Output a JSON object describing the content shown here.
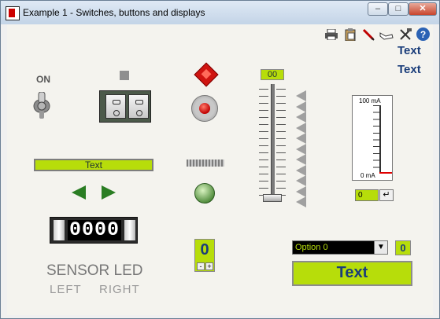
{
  "window": {
    "title": "Example 1 - Switches, buttons and displays",
    "buttons": {
      "minimize": "–",
      "maximize": "□",
      "close": "✕"
    }
  },
  "toolbar": {
    "icons": [
      "printer-icon",
      "clipboard-icon",
      "pen-icon",
      "hand-icon",
      "tools-icon",
      "help-icon"
    ],
    "help_glyph": "?"
  },
  "labels": {
    "text_top1": "Text",
    "text_top2": "Text",
    "on": "ON",
    "green_bar": "Text",
    "sensor": "SENSOR LED",
    "left": "LEFT",
    "right": "RIGHT",
    "big_button": "Text"
  },
  "counter": {
    "digits": "0000"
  },
  "slider": {
    "display": "00"
  },
  "meter": {
    "top_label": "100 mA",
    "bottom_label": "0 mA",
    "value_fraction": 0.0,
    "input_value": "0",
    "enter_glyph": "↵"
  },
  "stepper": {
    "value": "0",
    "minus": "-",
    "plus": "+"
  },
  "select": {
    "value": "Option 0",
    "arrow": "▼",
    "number": "0"
  },
  "colors": {
    "accent_green": "#b7dd0a",
    "title_blue": "#1a3d7a",
    "led_red": "#cf1410",
    "arrow_green": "#2a7d23"
  }
}
